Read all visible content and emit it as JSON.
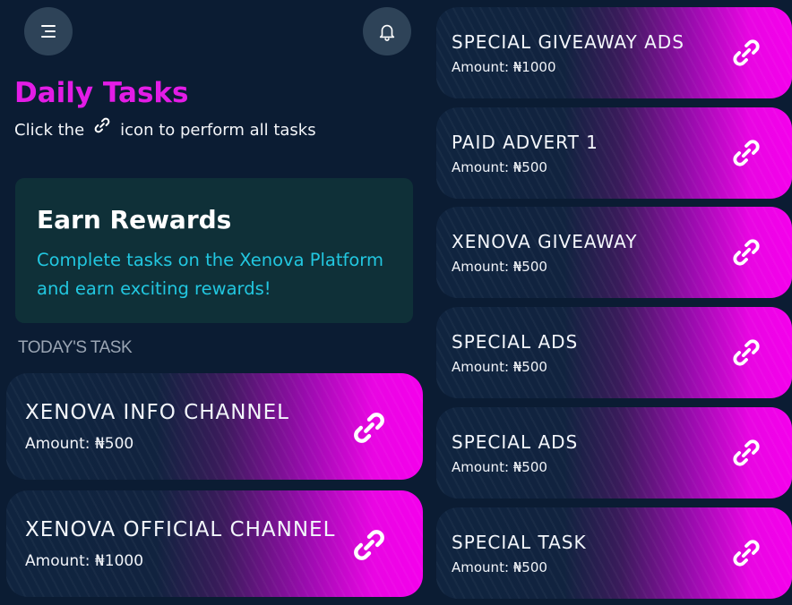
{
  "header": {
    "menu_icon": "menu-icon",
    "bell_icon": "bell-icon",
    "title": "Daily Tasks",
    "subtitle_before": "Click the",
    "subtitle_icon": "link-icon",
    "subtitle_after": "icon to perform all tasks"
  },
  "reward_card": {
    "title": "Earn Rewards",
    "description": "Complete tasks on the Xenova Platform and earn exciting rewards!"
  },
  "section_label": "TODAY'S TASK",
  "tasks_left": [
    {
      "name": "XENOVA INFO CHANNEL",
      "amount": "Amount: ₦500"
    },
    {
      "name": "XENOVA OFFICIAL CHANNEL",
      "amount": "Amount: ₦1000"
    }
  ],
  "tasks_right": [
    {
      "name": "SPECIAL GIVEAWAY ADS",
      "amount": "Amount: ₦1000"
    },
    {
      "name": "PAID ADVERT 1",
      "amount": "Amount: ₦500"
    },
    {
      "name": "XENOVA GIVEAWAY",
      "amount": "Amount: ₦500"
    },
    {
      "name": "SPECIAL ADS",
      "amount": "Amount: ₦500"
    },
    {
      "name": "SPECIAL ADS",
      "amount": "Amount: ₦500"
    },
    {
      "name": "SPECIAL TASK",
      "amount": "Amount: ₦500"
    }
  ],
  "colors": {
    "background": "#0b1c33",
    "title": "#e31ce6",
    "reward_card": "#0f3038",
    "reward_text": "#22c7e0",
    "card_gradient_end": "#f400ec"
  }
}
